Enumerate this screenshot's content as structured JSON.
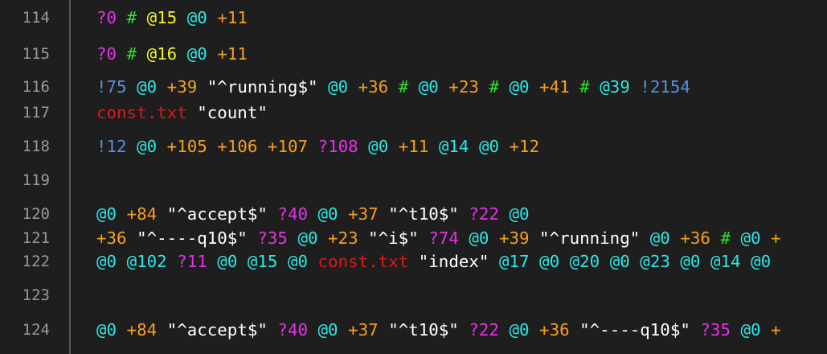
{
  "colors": {
    "q": "#e632e6",
    "h": "#2fe02f",
    "y": "#f2f02a",
    "a": "#2fe6e6",
    "p": "#f5a020",
    "b": "#5a8fe0",
    "r": "#d81c1c",
    "s": "#ffffff"
  },
  "lines": [
    {
      "num": "114",
      "tokens": [
        {
          "t": "q",
          "v": "?0"
        },
        {
          "t": "h",
          "v": "#"
        },
        {
          "t": "y",
          "v": "@15"
        },
        {
          "t": "a",
          "v": "@0"
        },
        {
          "t": "p",
          "v": "+11"
        }
      ]
    },
    {
      "num": "115",
      "tokens": [
        {
          "t": "q",
          "v": "?0"
        },
        {
          "t": "h",
          "v": "#"
        },
        {
          "t": "y",
          "v": "@16"
        },
        {
          "t": "a",
          "v": "@0"
        },
        {
          "t": "p",
          "v": "+11"
        }
      ]
    },
    {
      "num": "116",
      "tokens": [
        {
          "t": "b",
          "v": "!75"
        },
        {
          "t": "a",
          "v": "@0"
        },
        {
          "t": "p",
          "v": "+39"
        },
        {
          "t": "s",
          "v": "\"^running$\""
        },
        {
          "t": "a",
          "v": "@0"
        },
        {
          "t": "p",
          "v": "+36"
        },
        {
          "t": "h",
          "v": "#"
        },
        {
          "t": "a",
          "v": "@0"
        },
        {
          "t": "p",
          "v": "+23"
        },
        {
          "t": "h",
          "v": "#"
        },
        {
          "t": "a",
          "v": "@0"
        },
        {
          "t": "p",
          "v": "+41"
        },
        {
          "t": "h",
          "v": "#"
        },
        {
          "t": "a",
          "v": "@39"
        },
        {
          "t": "b",
          "v": "!2154"
        }
      ]
    },
    {
      "num": "117",
      "tokens": [
        {
          "t": "r",
          "v": "const.txt"
        },
        {
          "t": "s",
          "v": "\"count\""
        }
      ]
    },
    {
      "num": "118",
      "tokens": [
        {
          "t": "b",
          "v": "!12"
        },
        {
          "t": "a",
          "v": "@0"
        },
        {
          "t": "p",
          "v": "+105"
        },
        {
          "t": "p",
          "v": "+106"
        },
        {
          "t": "p",
          "v": "+107"
        },
        {
          "t": "q",
          "v": "?108"
        },
        {
          "t": "a",
          "v": "@0"
        },
        {
          "t": "p",
          "v": "+11"
        },
        {
          "t": "a",
          "v": "@14"
        },
        {
          "t": "a",
          "v": "@0"
        },
        {
          "t": "p",
          "v": "+12"
        }
      ]
    },
    {
      "num": "119",
      "tokens": []
    },
    {
      "num": "120",
      "tokens": [
        {
          "t": "a",
          "v": "@0"
        },
        {
          "t": "p",
          "v": "+84"
        },
        {
          "t": "s",
          "v": "\"^accept$\""
        },
        {
          "t": "q",
          "v": "?40"
        },
        {
          "t": "a",
          "v": "@0"
        },
        {
          "t": "p",
          "v": "+37"
        },
        {
          "t": "s",
          "v": "\"^t10$\""
        },
        {
          "t": "q",
          "v": "?22"
        },
        {
          "t": "a",
          "v": "@0"
        }
      ]
    },
    {
      "num": "121",
      "tokens": [
        {
          "t": "p",
          "v": "+36"
        },
        {
          "t": "s",
          "v": "\"^----q10$\""
        },
        {
          "t": "q",
          "v": "?35"
        },
        {
          "t": "a",
          "v": "@0"
        },
        {
          "t": "p",
          "v": "+23"
        },
        {
          "t": "s",
          "v": "\"^i$\""
        },
        {
          "t": "q",
          "v": "?74"
        },
        {
          "t": "a",
          "v": "@0"
        },
        {
          "t": "p",
          "v": "+39"
        },
        {
          "t": "s",
          "v": "\"^running\""
        },
        {
          "t": "a",
          "v": "@0"
        },
        {
          "t": "p",
          "v": "+36"
        },
        {
          "t": "h",
          "v": "#"
        },
        {
          "t": "a",
          "v": "@0"
        },
        {
          "t": "p",
          "v": "+"
        }
      ]
    },
    {
      "num": "122",
      "tokens": [
        {
          "t": "a",
          "v": "@0"
        },
        {
          "t": "a",
          "v": "@102"
        },
        {
          "t": "q",
          "v": "?11"
        },
        {
          "t": "a",
          "v": "@0"
        },
        {
          "t": "a",
          "v": "@15"
        },
        {
          "t": "a",
          "v": "@0"
        },
        {
          "t": "r",
          "v": "const.txt"
        },
        {
          "t": "s",
          "v": "\"index\""
        },
        {
          "t": "a",
          "v": "@17"
        },
        {
          "t": "a",
          "v": "@0"
        },
        {
          "t": "a",
          "v": "@20"
        },
        {
          "t": "a",
          "v": "@0"
        },
        {
          "t": "a",
          "v": "@23"
        },
        {
          "t": "a",
          "v": "@0"
        },
        {
          "t": "a",
          "v": "@14"
        },
        {
          "t": "a",
          "v": "@0"
        }
      ]
    },
    {
      "num": "123",
      "tokens": []
    },
    {
      "num": "124",
      "tokens": [
        {
          "t": "a",
          "v": "@0"
        },
        {
          "t": "p",
          "v": "+84"
        },
        {
          "t": "s",
          "v": "\"^accept$\""
        },
        {
          "t": "q",
          "v": "?40"
        },
        {
          "t": "a",
          "v": "@0"
        },
        {
          "t": "p",
          "v": "+37"
        },
        {
          "t": "s",
          "v": "\"^t10$\""
        },
        {
          "t": "q",
          "v": "?22"
        },
        {
          "t": "a",
          "v": "@0"
        },
        {
          "t": "p",
          "v": "+36"
        },
        {
          "t": "s",
          "v": "\"^----q10$\""
        },
        {
          "t": "q",
          "v": "?35"
        },
        {
          "t": "a",
          "v": "@0"
        },
        {
          "t": "p",
          "v": "+"
        }
      ]
    }
  ]
}
